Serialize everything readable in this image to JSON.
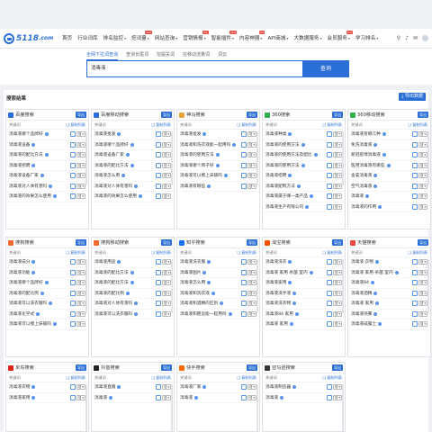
{
  "logo": {
    "brand": "5118",
    "tld": ".com"
  },
  "nav": [
    {
      "label": "首页",
      "caret": false,
      "hot": ""
    },
    {
      "label": "行业词库",
      "caret": false,
      "hot": ""
    },
    {
      "label": "排名监控",
      "caret": true,
      "hot": ""
    },
    {
      "label": "挖词量",
      "caret": true,
      "hot": "new"
    },
    {
      "label": "网站查询",
      "caret": true,
      "hot": ""
    },
    {
      "label": "营销情报",
      "caret": true,
      "hot": "hot"
    },
    {
      "label": "智能插件",
      "caret": true,
      "hot": "new"
    },
    {
      "label": "内容神器",
      "caret": true,
      "hot": "hot"
    },
    {
      "label": "API商城",
      "caret": true,
      "hot": ""
    },
    {
      "label": "大数据服务",
      "caret": true,
      "hot": ""
    },
    {
      "label": "会员服务",
      "caret": true,
      "hot": "hot"
    },
    {
      "label": "学习排名",
      "caret": true,
      "hot": ""
    }
  ],
  "search": {
    "tabs": [
      "全网下拉词查询",
      "查询长尾词",
      "挖掘关词",
      "挖移动流量词",
      "词云"
    ],
    "active_tab": 0,
    "query": "消毒液",
    "button": "查询"
  },
  "results": {
    "title": "搜索结果",
    "export_all": "导出数据"
  },
  "panel_common": {
    "export": "导出",
    "col": "关键词",
    "copy": "复制列表",
    "select": "搜"
  },
  "panels": [
    {
      "name": "百度搜索",
      "color": "#2a6fd6",
      "rows": [
        "消毒液哪个品牌好",
        "消毒液设备",
        "消毒液的配比方法",
        "消毒液招聘",
        "消毒液设备厂家",
        "消毒液对人体有害吗",
        "消毒液的效果怎么使用"
      ]
    },
    {
      "name": "百度移动搜索",
      "color": "#2a6fd6",
      "rows": [
        "消毒液批发",
        "消毒液哪个品牌好",
        "消毒液设备厂家",
        "消毒液的配比方法",
        "消毒液怎么用",
        "消毒液对人体有害吗",
        "消毒液的效果怎么使用"
      ]
    },
    {
      "name": "神马搜索",
      "color": "#e8a23a",
      "rows": [
        "消毒液批发",
        "消毒液和洗衣液能一起用吗",
        "消毒液的使用方法",
        "消毒液哪个牌子好",
        "消毒液可以擦上床铺吗",
        "消毒液有哪些"
      ]
    },
    {
      "name": "360搜索",
      "color": "#2fb24b",
      "rows": [
        "消毒液种类",
        "消毒液的使用方法",
        "消毒液的使用方法及配比",
        "消毒液的使用方法",
        "消毒液招聘",
        "消毒液配制方法",
        "消毒液属于哪一类产品",
        "消毒液生产有限公司"
      ]
    },
    {
      "name": "360移动搜索",
      "color": "#2fb24b",
      "rows": [
        "消毒液有哪几种",
        "免洗消毒液",
        "新冠疫情消毒液",
        "医用消毒液有哪些",
        "含氯消毒液",
        "空气消毒液",
        "消毒液",
        "消毒液的作用"
      ]
    },
    {
      "name": "搜狗搜索",
      "color": "#f36b2c",
      "rows": [
        "消毒液成分",
        "消毒液功能",
        "消毒液哪个品牌好",
        "消毒液的配比例",
        "消毒液可以洗衣服吗",
        "消毒液化学式",
        "消毒液可以擦上床铺吗"
      ]
    },
    {
      "name": "搜狗移动搜索",
      "color": "#f36b2c",
      "rows": [
        "消毒液用途",
        "消毒液的配比方法",
        "消毒液的配比方法",
        "消毒液的配比例",
        "消毒液对人体有害吗",
        "消毒液可以洗衣服吗"
      ]
    },
    {
      "name": "知乎搜索",
      "color": "#1772f6",
      "rows": [
        "消毒液洗衣服",
        "消毒液图片",
        "消毒液怎么用",
        "消毒液和洗衣液",
        "消毒液和酒精的区别",
        "消毒液和肥皂能一起用吗"
      ]
    },
    {
      "name": "淘宝搜索",
      "color": "#ff5000",
      "rows": [
        "消毒液洗衣",
        "消毒液 家用 杀菌 室内",
        "消毒液家用",
        "消毒液洗手液",
        "消毒液洗衣物",
        "消毒液84 家用",
        "消毒液 家用"
      ]
    },
    {
      "name": "天猫搜索",
      "color": "#e8463f",
      "rows": [
        "消毒液 衣物",
        "消毒液 家用 杀菌 室内",
        "消毒液84",
        "消毒液酒精",
        "消毒液 家用",
        "消毒液喷雾",
        "消毒液威露士"
      ]
    },
    {
      "name": "京东搜索",
      "color": "#e1251b",
      "rows": [
        "消毒液衣物",
        "消毒液家用"
      ]
    },
    {
      "name": "抖音搜索",
      "color": "#222222",
      "rows": [
        "消毒液直播",
        "消毒液"
      ]
    },
    {
      "name": "快手搜索",
      "color": "#ff6a00",
      "rows": [
        "消毒液厂家",
        "消毒液"
      ]
    },
    {
      "name": "亚马逊搜索",
      "color": "#333333",
      "rows": [
        "消毒液制造器",
        "消毒液"
      ]
    }
  ]
}
